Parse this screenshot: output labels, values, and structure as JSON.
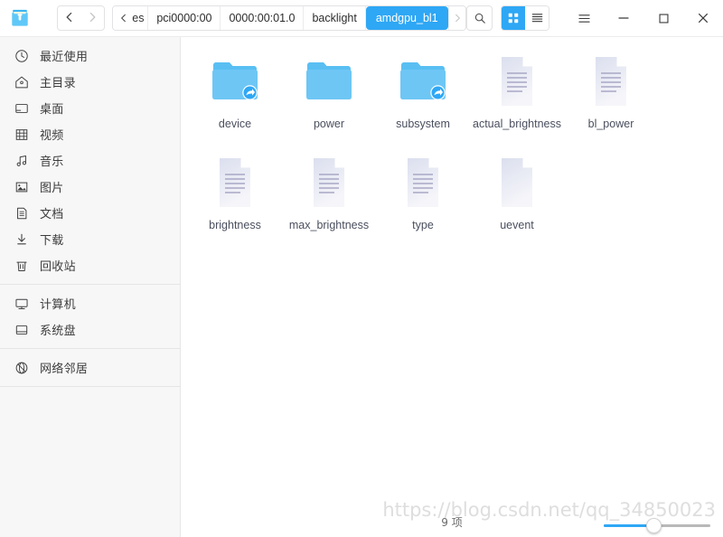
{
  "window": {
    "app_icon": "file-cabinet-icon",
    "controls": {
      "menu": "menu-icon",
      "minimize": "minimize-icon",
      "maximize": "maximize-icon",
      "close": "close-icon"
    }
  },
  "toolbar": {
    "back": "back-arrow-icon",
    "forward": "forward-arrow-icon",
    "search": "search-icon",
    "view_grid": "grid-view-icon",
    "view_list": "list-view-icon",
    "active_view": "grid"
  },
  "breadcrumb": {
    "overflow_label": "es",
    "items": [
      {
        "label": "pci0000:00",
        "active": false
      },
      {
        "label": "0000:00:01.0",
        "active": false
      },
      {
        "label": "backlight",
        "active": false
      },
      {
        "label": "amdgpu_bl1",
        "active": true
      }
    ]
  },
  "sidebar": {
    "groups": [
      {
        "items": [
          {
            "label": "最近使用",
            "icon": "clock-icon"
          },
          {
            "label": "主目录",
            "icon": "home-icon"
          },
          {
            "label": "桌面",
            "icon": "desktop-icon"
          },
          {
            "label": "视频",
            "icon": "video-icon"
          },
          {
            "label": "音乐",
            "icon": "music-icon"
          },
          {
            "label": "图片",
            "icon": "picture-icon"
          },
          {
            "label": "文档",
            "icon": "document-icon"
          },
          {
            "label": "下载",
            "icon": "download-icon"
          },
          {
            "label": "回收站",
            "icon": "trash-icon"
          }
        ]
      },
      {
        "items": [
          {
            "label": "计算机",
            "icon": "computer-icon"
          },
          {
            "label": "系统盘",
            "icon": "disk-icon"
          }
        ]
      },
      {
        "items": [
          {
            "label": "网络邻居",
            "icon": "network-icon"
          }
        ]
      }
    ]
  },
  "files": [
    {
      "name": "device",
      "type": "folder-link",
      "icon": "folder-symlink-icon"
    },
    {
      "name": "power",
      "type": "folder",
      "icon": "folder-icon"
    },
    {
      "name": "subsystem",
      "type": "folder-link",
      "icon": "folder-symlink-icon"
    },
    {
      "name": "actual_brightness",
      "type": "text-file",
      "icon": "text-file-icon"
    },
    {
      "name": "bl_power",
      "type": "text-file",
      "icon": "text-file-icon"
    },
    {
      "name": "brightness",
      "type": "text-file",
      "icon": "text-file-icon"
    },
    {
      "name": "max_brightness",
      "type": "text-file",
      "icon": "text-file-icon"
    },
    {
      "name": "type",
      "type": "text-file",
      "icon": "text-file-icon"
    },
    {
      "name": "uevent",
      "type": "blank-file",
      "icon": "blank-file-icon"
    }
  ],
  "statusbar": {
    "item_count": "9 项",
    "zoom_percent": 46
  },
  "watermark": "https://blog.csdn.net/qq_34850023",
  "colors": {
    "accent": "#2ea7f5",
    "folder": "#6ec6f5",
    "sidebar_bg": "#f7f7f8",
    "content_bg": "#ffffff",
    "text": "#3b3b3b",
    "file_label": "#4a4f5e",
    "doc_fill": "#dfe2ef",
    "doc_line": "#a9a7c6"
  }
}
